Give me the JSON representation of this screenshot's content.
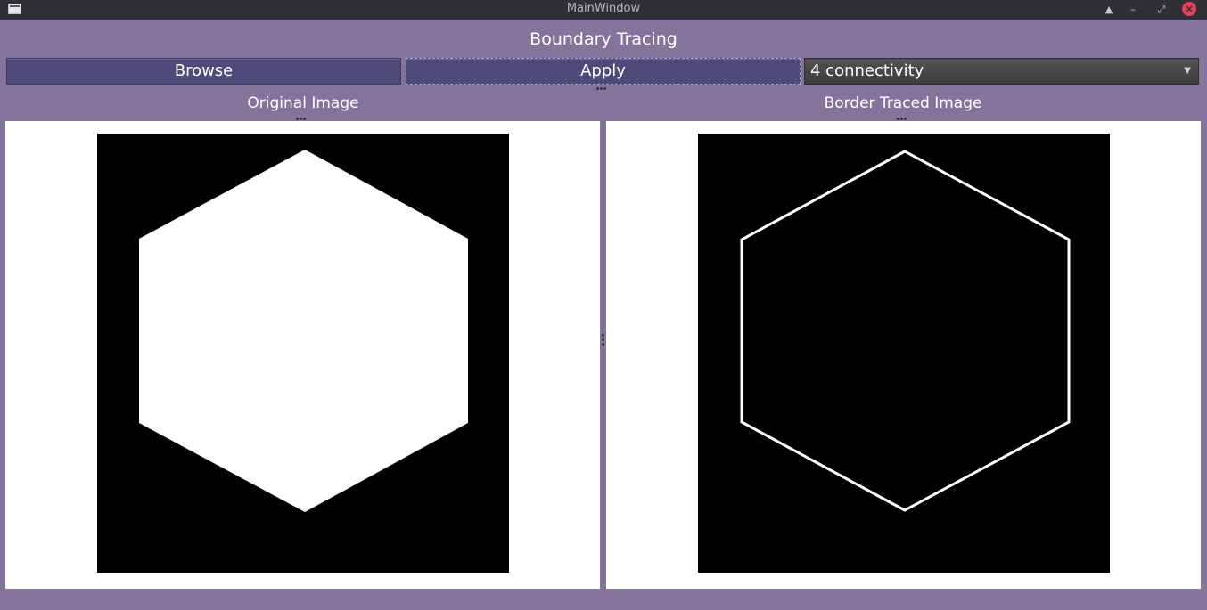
{
  "window": {
    "title": "MainWindow",
    "eject_icon": "eject-icon",
    "minimize_icon": "minimize-icon",
    "maximize_icon": "maximize-icon",
    "close_icon": "close-icon"
  },
  "app": {
    "heading": "Boundary Tracing"
  },
  "toolbar": {
    "browse_label": "Browse",
    "apply_label": "Apply",
    "connectivity_selected": "4 connectivity"
  },
  "panels": {
    "left_title": "Original Image",
    "right_title": "Border Traced Image"
  },
  "colors": {
    "background": "#84739a",
    "button": "#4e4a7a",
    "titlebar": "#302f34",
    "close": "#e0445a"
  }
}
